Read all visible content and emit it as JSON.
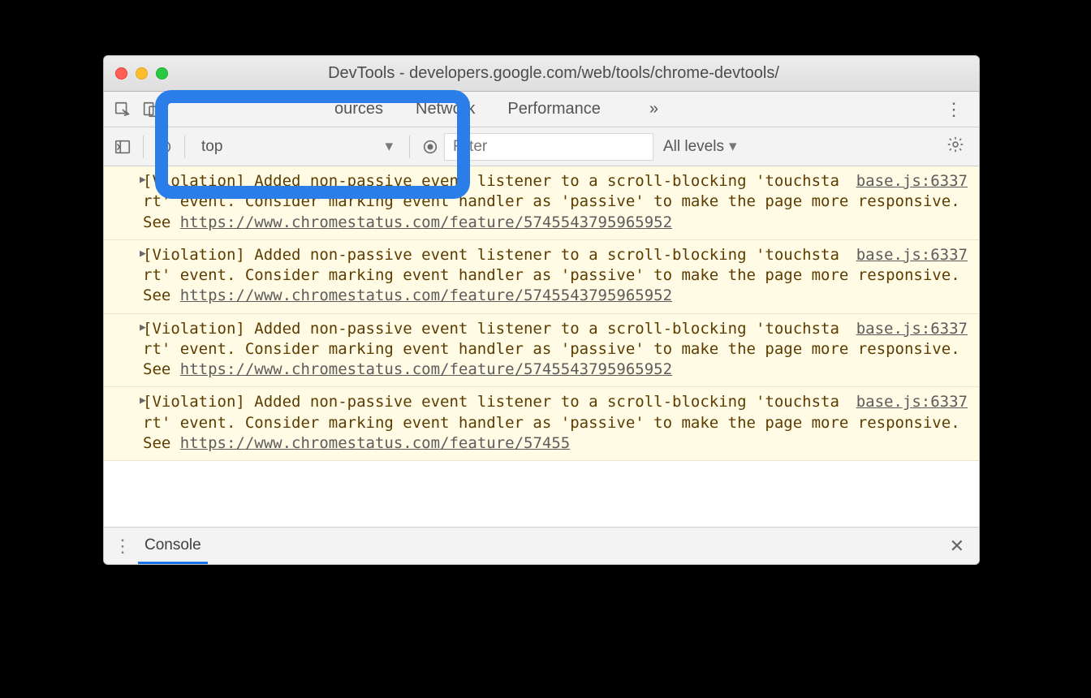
{
  "window": {
    "title": "DevTools - developers.google.com/web/tools/chrome-devtools/"
  },
  "tabs": {
    "sources": "ources",
    "network": "Network",
    "performance": "Performance"
  },
  "toolbar": {
    "context": "top",
    "filter_placeholder": "Filter",
    "levels": "All levels"
  },
  "messages": [
    {
      "prefix": "[Violation] Added non-passive event listener to a scroll-blocking 'touchstart' event. Consider marking event handler as 'passive' to make the page more responsive. See ",
      "link": "https://www.chromestatus.com/feature/5745543795965952",
      "source": "base.js:6337"
    },
    {
      "prefix": "[Violation] Added non-passive event listener to a scroll-blocking 'touchstart' event. Consider marking event handler as 'passive' to make the page more responsive. See ",
      "link": "https://www.chromestatus.com/feature/5745543795965952",
      "source": "base.js:6337"
    },
    {
      "prefix": "[Violation] Added non-passive event listener to a scroll-blocking 'touchstart' event. Consider marking event handler as 'passive' to make the page more responsive. See ",
      "link": "https://www.chromestatus.com/feature/5745543795965952",
      "source": "base.js:6337"
    },
    {
      "prefix": "[Violation] Added non-passive event listener to a scroll-blocking 'touchstart' event. Consider marking event handler as 'passive' to make the page more responsive. See ",
      "link": "https://www.chromestatus.com/feature/57455",
      "source": "base.js:6337"
    }
  ],
  "drawer": {
    "tab": "Console"
  }
}
